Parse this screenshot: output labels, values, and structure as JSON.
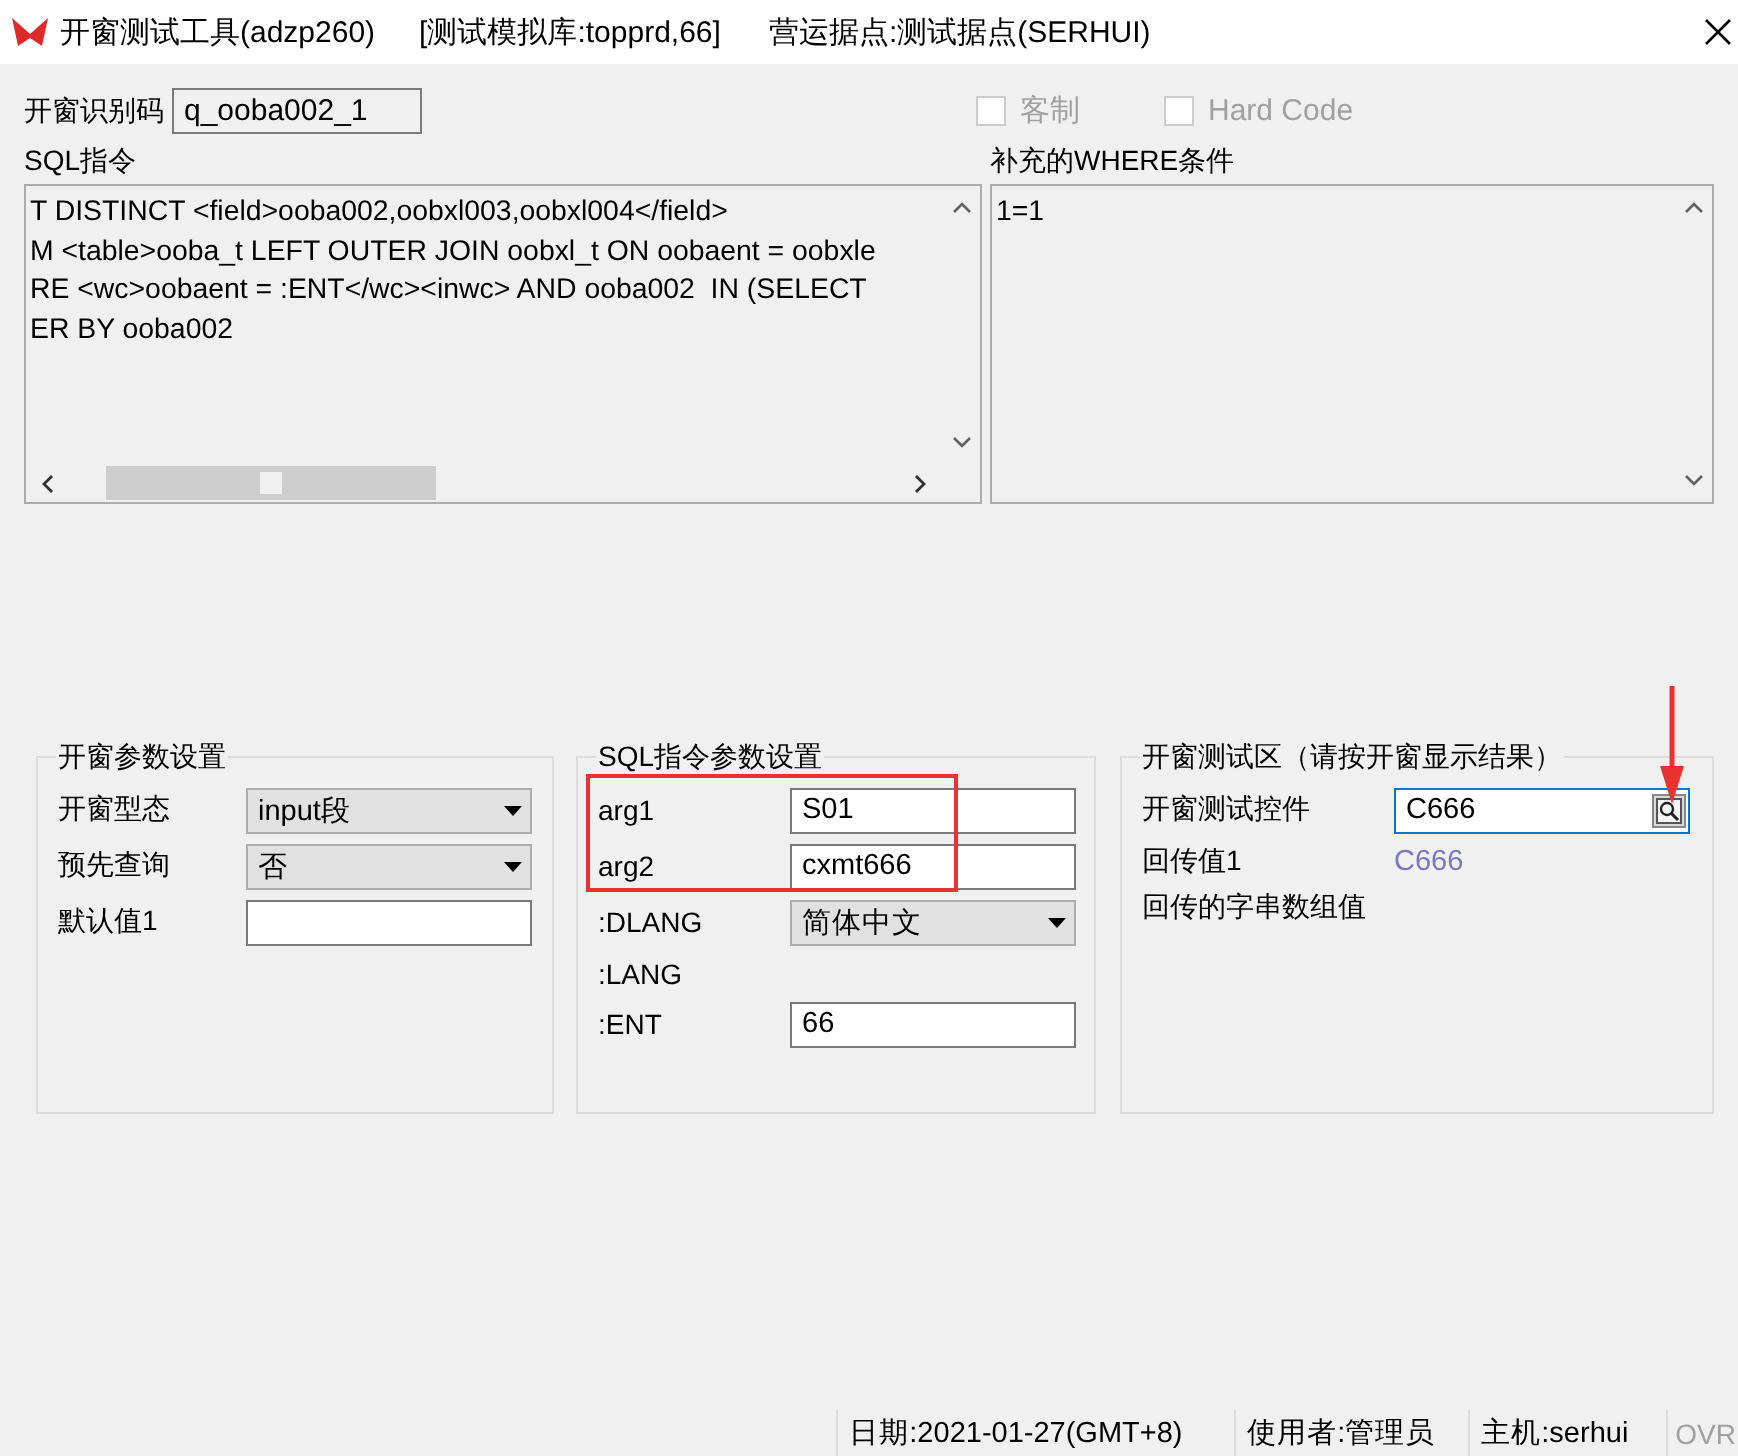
{
  "window": {
    "title": "开窗测试工具(adzp260)",
    "database": "[测试模拟库:topprd,66]",
    "site": "营运据点:测试据点(SERHUI)"
  },
  "header": {
    "id_label": "开窗识别码",
    "id_value": "q_ooba002_1",
    "checkboxes": [
      {
        "label": "客制",
        "checked": false,
        "disabled": true
      },
      {
        "label": "Hard Code",
        "checked": false,
        "disabled": true
      }
    ]
  },
  "sql": {
    "label": "SQL指令",
    "lines": [
      "T DISTINCT <field>ooba002,oobxl003,oobxl004</field>",
      "M <table>ooba_t LEFT OUTER JOIN oobxl_t ON oobaent = oobxle",
      "RE <wc>oobaent = :ENT</wc><inwc> AND ooba002  IN (SELECT",
      "ER BY ooba002"
    ]
  },
  "where": {
    "label": "补充的WHERE条件",
    "value": "1=1"
  },
  "groups": [
    {
      "title": "开窗参数设置",
      "rows": [
        {
          "kind": "combo",
          "label": "开窗型态",
          "value": "input段"
        },
        {
          "kind": "combo",
          "label": "预先查询",
          "value": "否"
        },
        {
          "kind": "field",
          "label": "默认值1"
        }
      ]
    },
    {
      "title": "SQL指令参数设置",
      "rows": [
        {
          "kind": "field",
          "label": "arg1",
          "value": "S01"
        },
        {
          "kind": "field",
          "label": "arg2",
          "value": "cxmt666"
        },
        {
          "kind": "combo",
          "label": ":DLANG",
          "value": "简体中文"
        },
        {
          "kind": "label",
          "label": ":LANG"
        },
        {
          "kind": "field",
          "label": ":ENT",
          "value": "66"
        }
      ]
    },
    {
      "title": "开窗测试区（请按开窗显示结果）",
      "rows": [
        {
          "kind": "lookup",
          "label": "开窗测试控件",
          "value": "C666"
        },
        {
          "kind": "value",
          "label": "回传值1",
          "value": "C666"
        },
        {
          "kind": "label",
          "label": "回传的字串数组值"
        }
      ]
    }
  ],
  "status_bar": [
    {
      "text": "日期:2021-01-27(GMT+8)",
      "disabled": false
    },
    {
      "text": "使用者:管理员",
      "disabled": false
    },
    {
      "text": "主机:serhui",
      "disabled": false
    },
    {
      "text": "OVR",
      "disabled": true
    }
  ],
  "annotations": {
    "box": true,
    "arrow": true
  }
}
